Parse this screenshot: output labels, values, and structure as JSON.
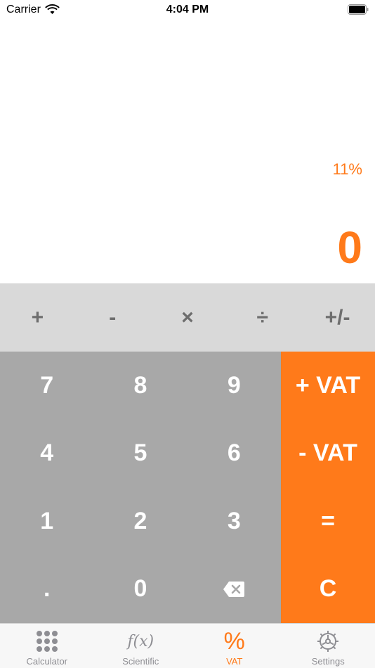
{
  "status_bar": {
    "carrier": "Carrier",
    "time": "4:04 PM"
  },
  "display": {
    "vat_rate": "11%",
    "result": "0"
  },
  "operators": [
    "+",
    "-",
    "×",
    "÷",
    "+/-"
  ],
  "keypad": {
    "keys": [
      "7",
      "8",
      "9",
      "4",
      "5",
      "6",
      "1",
      "2",
      "3",
      ".",
      "0"
    ],
    "backspace_icon": "backspace-icon"
  },
  "side_keys": [
    "+ VAT",
    "- VAT",
    "=",
    "C"
  ],
  "tabs": [
    {
      "label": "Calculator",
      "icon": "keypad-grid-icon"
    },
    {
      "label": "Scientific",
      "icon": "function-icon",
      "icon_text": "f(x)"
    },
    {
      "label": "VAT",
      "icon": "percent-icon",
      "icon_text": "%",
      "active": true
    },
    {
      "label": "Settings",
      "icon": "gear-icon"
    }
  ],
  "colors": {
    "accent": "#ff7a1a",
    "keypad": "#a8a8a8",
    "operator_row": "#d9d9d9",
    "operator_text": "#6e6e6e"
  }
}
